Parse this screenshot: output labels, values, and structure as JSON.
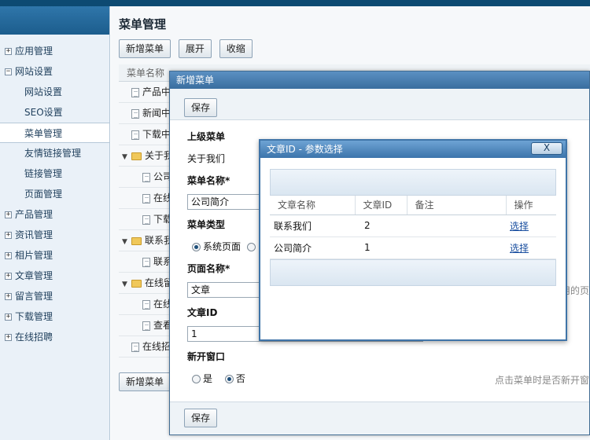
{
  "sidebar": {
    "items": [
      {
        "label": "应用管理",
        "toggle": "+",
        "indent": false
      },
      {
        "label": "网站设置",
        "toggle": "−",
        "indent": false
      },
      {
        "label": "网站设置",
        "toggle": "",
        "indent": true
      },
      {
        "label": "SEO设置",
        "toggle": "",
        "indent": true
      },
      {
        "label": "菜单管理",
        "toggle": "",
        "indent": true,
        "active": true
      },
      {
        "label": "友情链接管理",
        "toggle": "",
        "indent": true
      },
      {
        "label": "链接管理",
        "toggle": "",
        "indent": true
      },
      {
        "label": "页面管理",
        "toggle": "",
        "indent": true
      },
      {
        "label": "产品管理",
        "toggle": "+",
        "indent": false
      },
      {
        "label": "资讯管理",
        "toggle": "+",
        "indent": false
      },
      {
        "label": "相片管理",
        "toggle": "+",
        "indent": false
      },
      {
        "label": "文章管理",
        "toggle": "+",
        "indent": false
      },
      {
        "label": "留言管理",
        "toggle": "+",
        "indent": false
      },
      {
        "label": "下载管理",
        "toggle": "+",
        "indent": false
      },
      {
        "label": "在线招聘",
        "toggle": "+",
        "indent": false
      }
    ]
  },
  "main": {
    "title": "菜单管理",
    "toolbar": {
      "add": "新增菜单",
      "expand": "展开",
      "collapse": "收缩"
    },
    "tree_header": "菜单名称",
    "tree_rows": [
      {
        "label": "产品中",
        "kind": "doc",
        "level": 0
      },
      {
        "label": "新闻中",
        "kind": "doc",
        "level": 0
      },
      {
        "label": "下载中",
        "kind": "doc",
        "level": 0
      },
      {
        "label": "关于我",
        "kind": "folder",
        "level": 0
      },
      {
        "label": "公司",
        "kind": "doc",
        "level": 1
      },
      {
        "label": "在线",
        "kind": "doc",
        "level": 1
      },
      {
        "label": "下载",
        "kind": "doc",
        "level": 1
      },
      {
        "label": "联系我",
        "kind": "folder",
        "level": 0
      },
      {
        "label": "联系",
        "kind": "doc",
        "level": 1
      },
      {
        "label": "在线留",
        "kind": "folder",
        "level": 0
      },
      {
        "label": "在线",
        "kind": "doc",
        "level": 1
      },
      {
        "label": "查看",
        "kind": "doc",
        "level": 1
      },
      {
        "label": "在线招",
        "kind": "doc",
        "level": 0
      }
    ],
    "bottom_add": "新增菜单"
  },
  "dialog1": {
    "title": "新增菜单",
    "save": "保存",
    "parent_label": "上级菜单",
    "parent_value": "关于我们",
    "name_label": "菜单名称*",
    "name_value": "公司简介",
    "type_label": "菜单类型",
    "type_option1": "系统页面",
    "page_label": "页面名称*",
    "page_value": "文章",
    "page_hint": "用的页",
    "article_label": "文章ID",
    "article_value": "1",
    "newwin_label": "新开窗口",
    "newwin_yes": "是",
    "newwin_no": "否",
    "newwin_hint": "点击菜单时是否新开窗",
    "footer_save": "保存"
  },
  "dialog2": {
    "title": "文章ID - 参数选择",
    "close": "X",
    "columns": [
      "文章名称",
      "文章ID",
      "备注",
      "操作"
    ],
    "rows": [
      {
        "name": "联系我们",
        "id": "2",
        "note": "",
        "action": "选择"
      },
      {
        "name": "公司简介",
        "id": "1",
        "note": "",
        "action": "选择"
      }
    ]
  }
}
